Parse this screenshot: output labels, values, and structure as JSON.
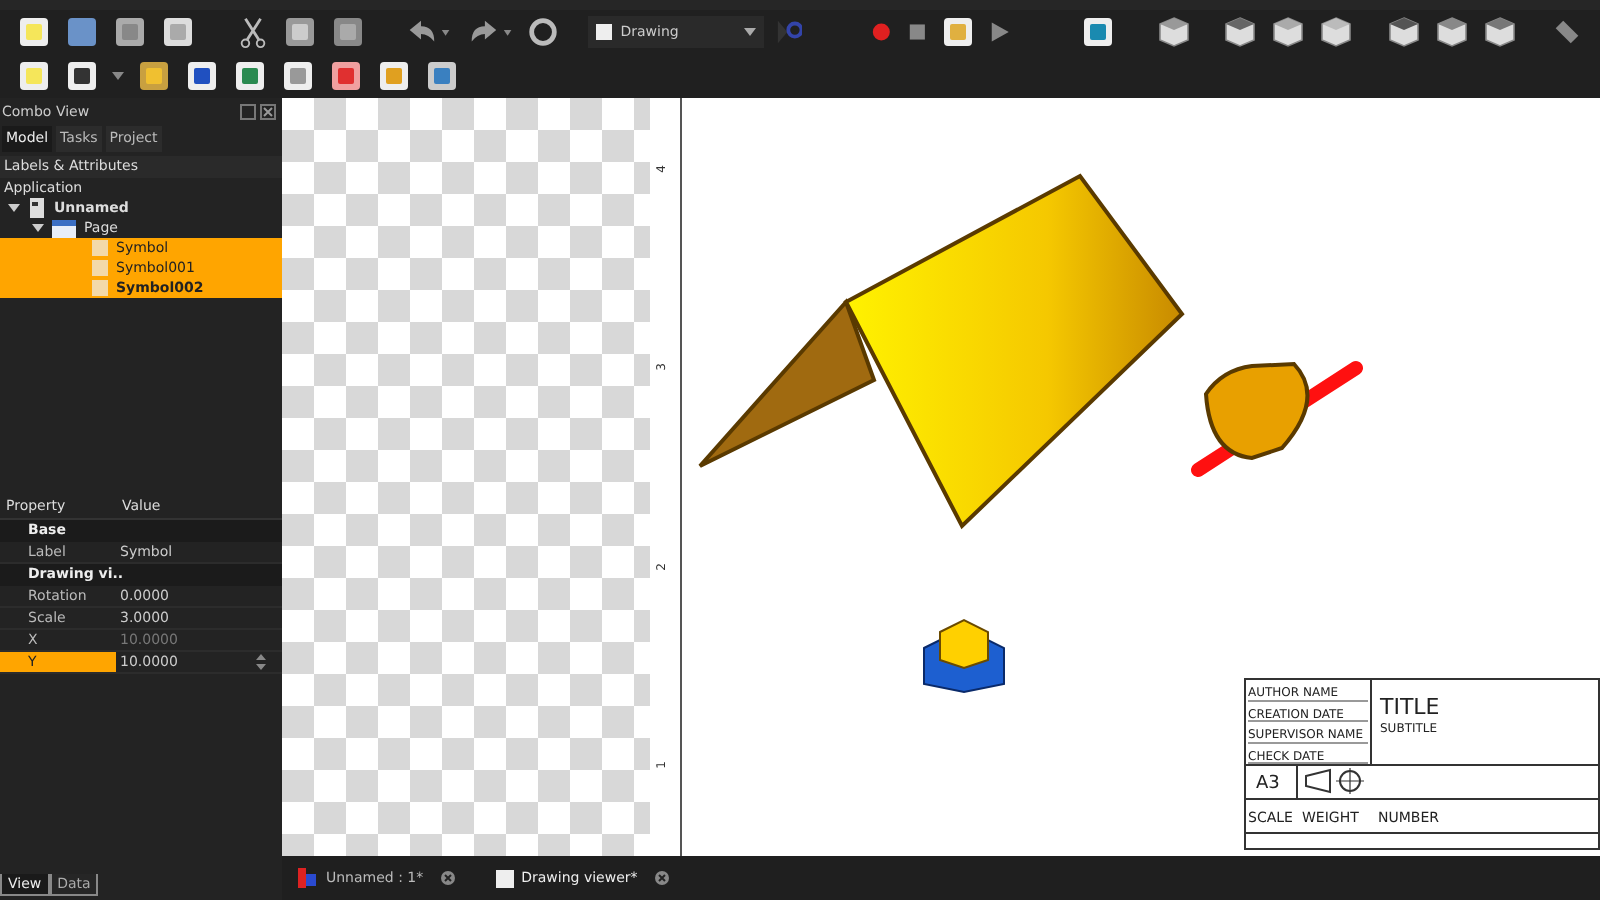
{
  "toolbar": {
    "workbench": "Drawing"
  },
  "combo_view": {
    "title": "Combo View",
    "tabs": [
      {
        "label": "Model",
        "selected": true
      },
      {
        "label": "Tasks",
        "selected": false
      },
      {
        "label": "Project",
        "selected": false
      }
    ],
    "section": "Labels & Attributes",
    "tree": {
      "label": "Application",
      "children": [
        {
          "label": "Unnamed",
          "kind": "document",
          "expanded": true,
          "children": [
            {
              "label": "Page",
              "kind": "page",
              "expanded": true,
              "children": [
                {
                  "label": "Symbol",
                  "kind": "symbol",
                  "selected": true,
                  "current": false
                },
                {
                  "label": "Symbol001",
                  "kind": "symbol",
                  "selected": true,
                  "current": false
                },
                {
                  "label": "Symbol002",
                  "kind": "symbol",
                  "selected": true,
                  "current": true
                }
              ]
            }
          ]
        }
      ]
    }
  },
  "properties": {
    "columns": [
      "Property",
      "Value"
    ],
    "rows": [
      {
        "kind": "group",
        "label": "Base"
      },
      {
        "kind": "prop",
        "label": "Label",
        "value": "Symbol",
        "selected": false,
        "dim": false
      },
      {
        "kind": "group",
        "label": "Drawing vi.."
      },
      {
        "kind": "prop",
        "label": "Rotation",
        "value": "0.0000",
        "selected": false,
        "dim": false
      },
      {
        "kind": "prop",
        "label": "Scale",
        "value": "3.0000",
        "selected": false,
        "dim": false
      },
      {
        "kind": "prop",
        "label": "X",
        "value": "10.0000",
        "selected": false,
        "dim": true
      },
      {
        "kind": "prop",
        "label": "Y",
        "value": "10.0000",
        "selected": true,
        "dim": false
      }
    ]
  },
  "panel_tabs": [
    {
      "label": "View",
      "selected": true
    },
    {
      "label": "Data",
      "selected": false
    }
  ],
  "drawing": {
    "ruler": [
      "4",
      "3",
      "2",
      "1"
    ],
    "title_block": {
      "author": "AUTHOR NAME",
      "creation": "CREATION DATE",
      "supervisor": "SUPERVISOR NAME",
      "check": "CHECK DATE",
      "format": "A3",
      "title": "TITLE",
      "subtitle": "SUBTITLE",
      "scale": "SCALE",
      "weight": "WEIGHT",
      "number": "NUMBER"
    }
  },
  "document_tabs": [
    {
      "label": "Unnamed : 1*",
      "kind": "document",
      "selected": false
    },
    {
      "label": "Drawing viewer*",
      "kind": "drawing",
      "selected": true
    }
  ]
}
